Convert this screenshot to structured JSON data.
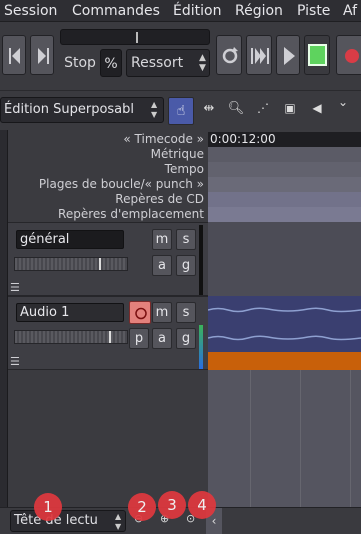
{
  "menu": [
    "Session",
    "Commandes",
    "Édition",
    "Région",
    "Piste",
    "Af"
  ],
  "transport": {
    "stop_label": "Stop",
    "percent_label": "%",
    "ressort_label": "Ressort"
  },
  "edit_mode": "Édition Superposabl",
  "rulers": {
    "labels": [
      "« Timecode »",
      "Métrique",
      "Tempo",
      "Plages de boucle/« punch »",
      "Repères de CD",
      "Repères d'emplacement"
    ],
    "timecode_value": "0:00:12:00"
  },
  "tracks": {
    "master": {
      "name": "général",
      "m": "m",
      "s": "s",
      "a": "a",
      "g": "g"
    },
    "audio": {
      "name": "Audio 1",
      "m": "m",
      "s": "s",
      "p": "p",
      "a": "a",
      "g": "g"
    }
  },
  "bottom": {
    "playhead_combo": "Tête de lectu",
    "badges": [
      "1",
      "2",
      "3",
      "4"
    ]
  },
  "colors": {
    "record_active": "#e06060",
    "play_green": "#5ed35e",
    "region_orange": "#c8600a",
    "waveform_blue": "#3a3f70"
  }
}
